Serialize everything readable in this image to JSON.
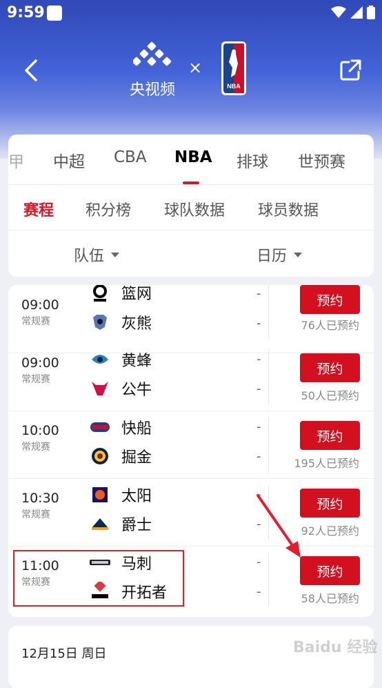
{
  "status_bar": {
    "time": "9:59"
  },
  "header": {
    "brand": "央视频",
    "times_symbol": "×",
    "nba_logo_text": "NBA"
  },
  "tabs": [
    "甲",
    "中超",
    "CBA",
    "NBA",
    "排球",
    "世预赛"
  ],
  "active_tab": "NBA",
  "subtabs": [
    "赛程",
    "积分榜",
    "球队数据",
    "球员数据"
  ],
  "active_subtab": "赛程",
  "filters": {
    "team": "队伍",
    "calendar": "日历"
  },
  "matches": [
    {
      "time": "09:00",
      "type": "常规赛",
      "home": "篮网",
      "away": "灰熊",
      "home_score": "-",
      "away_score": "-",
      "button": "预约",
      "count": "76人已预约"
    },
    {
      "time": "09:00",
      "type": "常规赛",
      "home": "黄蜂",
      "away": "公牛",
      "home_score": "-",
      "away_score": "-",
      "button": "预约",
      "count": "50人已预约"
    },
    {
      "time": "10:00",
      "type": "常规赛",
      "home": "快船",
      "away": "掘金",
      "home_score": "-",
      "away_score": "-",
      "button": "预约",
      "count": "195人已预约"
    },
    {
      "time": "10:30",
      "type": "常规赛",
      "home": "太阳",
      "away": "爵士",
      "home_score": "-",
      "away_score": "-",
      "button": "预约",
      "count": "92人已预约"
    },
    {
      "time": "11:00",
      "type": "常规赛",
      "home": "马刺",
      "away": "开拓者",
      "home_score": "-",
      "away_score": "-",
      "button": "预约",
      "count": "58人已预约"
    }
  ],
  "next_date": "12月15日 周日",
  "watermark": "Baidu 经验",
  "colors": {
    "accent": "#d3101f",
    "header": "#3148b8"
  }
}
